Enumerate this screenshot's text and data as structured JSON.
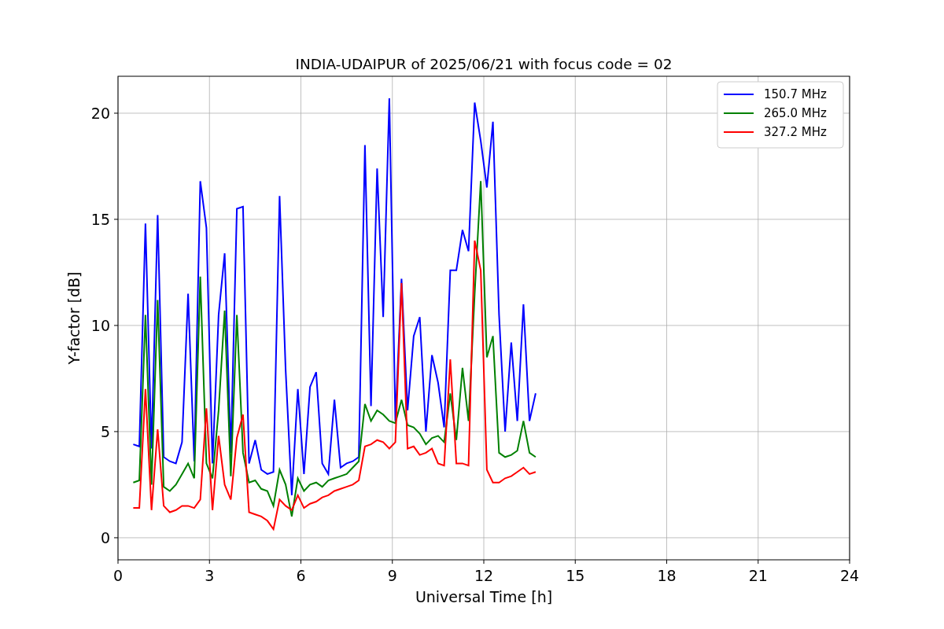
{
  "figure": {
    "chart_data": {
      "type": "line",
      "title": "INDIA-UDAIPUR of 2025/06/21 with focus code = 02",
      "xlabel": "Universal Time [h]",
      "ylabel": "Y-factor [dB]",
      "x": [
        0.5,
        0.7,
        0.9,
        1.1,
        1.3,
        1.5,
        1.7,
        1.9,
        2.1,
        2.3,
        2.5,
        2.7,
        2.9,
        3.1,
        3.3,
        3.5,
        3.7,
        3.9,
        4.1,
        4.3,
        4.5,
        4.7,
        4.9,
        5.1,
        5.3,
        5.5,
        5.7,
        5.9,
        6.1,
        6.3,
        6.5,
        6.7,
        6.9,
        7.1,
        7.3,
        7.5,
        7.7,
        7.9,
        8.1,
        8.3,
        8.5,
        8.7,
        8.9,
        9.1,
        9.3,
        9.5,
        9.7,
        9.9,
        10.1,
        10.3,
        10.5,
        10.7,
        10.9,
        11.1,
        11.3,
        11.5,
        11.7,
        11.9,
        12.1,
        12.3,
        12.5,
        12.7,
        12.9,
        13.1,
        13.3,
        13.5,
        13.7
      ],
      "series": [
        {
          "name": "150.7 MHz",
          "color": "#0000ff",
          "values": [
            4.4,
            4.3,
            14.8,
            4.2,
            15.2,
            3.8,
            3.6,
            3.5,
            4.5,
            11.5,
            3.6,
            16.8,
            14.6,
            3.5,
            10.5,
            13.4,
            4.0,
            15.5,
            15.6,
            3.5,
            4.6,
            3.2,
            3.0,
            3.1,
            16.1,
            7.9,
            2.0,
            7.0,
            3.0,
            7.1,
            7.8,
            3.5,
            3.0,
            6.5,
            3.3,
            3.5,
            3.6,
            3.8,
            18.5,
            6.2,
            17.4,
            10.4,
            20.7,
            5.5,
            12.2,
            6.0,
            9.5,
            10.4,
            5.0,
            8.6,
            7.3,
            5.2,
            12.6,
            12.6,
            14.5,
            13.5,
            20.5,
            18.7,
            16.5,
            19.6,
            10.5,
            5.0,
            9.2,
            5.5,
            11.0,
            5.5,
            6.8
          ]
        },
        {
          "name": "265.0 MHz",
          "color": "#008000",
          "values": [
            2.6,
            2.7,
            10.5,
            2.5,
            11.2,
            2.4,
            2.2,
            2.5,
            3.0,
            3.5,
            2.8,
            12.3,
            3.5,
            2.8,
            6.0,
            10.7,
            2.9,
            10.5,
            4.0,
            2.6,
            2.7,
            2.3,
            2.2,
            1.5,
            3.2,
            2.5,
            1.0,
            2.8,
            2.2,
            2.5,
            2.6,
            2.4,
            2.7,
            2.8,
            2.9,
            3.0,
            3.3,
            3.6,
            6.3,
            5.5,
            6.0,
            5.8,
            5.5,
            5.4,
            6.5,
            5.3,
            5.2,
            4.9,
            4.4,
            4.7,
            4.8,
            4.5,
            6.8,
            4.6,
            8.0,
            5.5,
            11.5,
            16.8,
            8.5,
            9.5,
            4.0,
            3.8,
            3.9,
            4.1,
            5.5,
            4.0,
            3.8
          ]
        },
        {
          "name": "327.2 MHz",
          "color": "#ff0000",
          "values": [
            1.4,
            1.4,
            7.0,
            1.3,
            5.1,
            1.5,
            1.2,
            1.3,
            1.5,
            1.5,
            1.4,
            1.8,
            6.1,
            1.3,
            4.8,
            2.5,
            1.8,
            4.7,
            5.8,
            1.2,
            1.1,
            1.0,
            0.8,
            0.4,
            1.8,
            1.5,
            1.3,
            2.0,
            1.4,
            1.6,
            1.7,
            1.9,
            2.0,
            2.2,
            2.3,
            2.4,
            2.5,
            2.7,
            4.3,
            4.4,
            4.6,
            4.5,
            4.2,
            4.5,
            12.0,
            4.2,
            4.3,
            3.9,
            4.0,
            4.2,
            3.5,
            3.4,
            8.4,
            3.5,
            3.5,
            3.4,
            14.0,
            12.6,
            3.2,
            2.6,
            2.6,
            2.8,
            2.9,
            3.1,
            3.3,
            3.0,
            3.1
          ]
        }
      ],
      "grid": true,
      "legend": true,
      "xlim": [
        0,
        24
      ],
      "ylim": [
        -1.04,
        21.74
      ],
      "xticks": [
        0,
        3,
        6,
        9,
        12,
        15,
        18,
        21,
        24
      ],
      "yticks": [
        0,
        5,
        10,
        15,
        20
      ]
    }
  }
}
